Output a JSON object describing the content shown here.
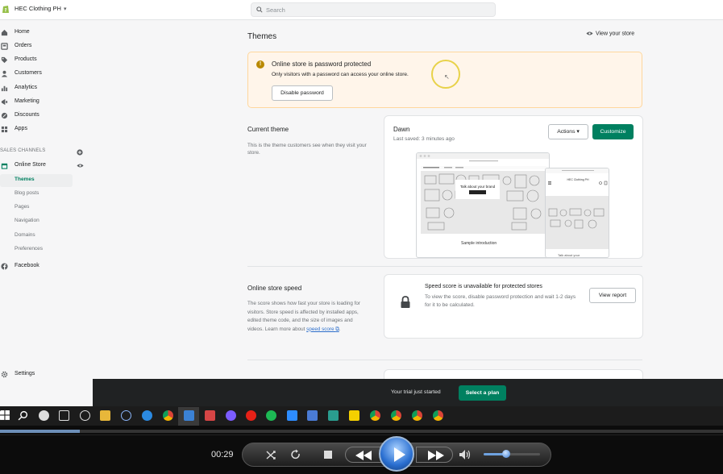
{
  "topbar": {
    "store_name": "HEC Clothing PH",
    "search_placeholder": "Search"
  },
  "sidebar": {
    "items": [
      {
        "label": "Home",
        "icon": "home-icon"
      },
      {
        "label": "Orders",
        "icon": "orders-icon"
      },
      {
        "label": "Products",
        "icon": "tag-icon"
      },
      {
        "label": "Customers",
        "icon": "person-icon"
      },
      {
        "label": "Analytics",
        "icon": "bar-chart-icon"
      },
      {
        "label": "Marketing",
        "icon": "megaphone-icon"
      },
      {
        "label": "Discounts",
        "icon": "discount-icon"
      },
      {
        "label": "Apps",
        "icon": "apps-icon"
      }
    ],
    "sales_channels_label": "SALES CHANNELS",
    "online_store_label": "Online Store",
    "online_store_sub": [
      "Themes",
      "Blog posts",
      "Pages",
      "Navigation",
      "Domains",
      "Preferences"
    ],
    "facebook_label": "Facebook",
    "settings_label": "Settings"
  },
  "main": {
    "page_title": "Themes",
    "view_store_label": "View your store",
    "banner": {
      "title": "Online store is password protected",
      "text": "Only visitors with a password can access your online store.",
      "button_label": "Disable password"
    },
    "current_theme": {
      "section_title": "Current theme",
      "section_desc": "This is the theme customers see when they visit your store.",
      "theme_name": "Dawn",
      "last_saved": "Last saved: 3 minutes ago",
      "actions_label": "Actions",
      "customize_label": "Customize",
      "preview": {
        "banner_text": "Talk about your brand",
        "sample_text": "Sample introduction",
        "mobile_store": "HEC Clothing PH",
        "mobile_caption": "Talk about your"
      }
    },
    "speed": {
      "section_title": "Online store speed",
      "section_desc": "The score shows how fast your store is loading for visitors. Store speed is affected by installed apps, edited theme code, and the size of images and videos. Learn more about",
      "link_label": "speed score",
      "card_title": "Speed score is unavailable for protected stores",
      "card_text": "To view the score, disable password protection and wait 1-2 days for it to be calculated.",
      "view_report_label": "View report"
    }
  },
  "trial_bar": {
    "text": "Your trial just started",
    "button_label": "Select a plan"
  },
  "player": {
    "time": "00:29",
    "progress": 0.11,
    "volume": 0.4
  },
  "colors": {
    "accent": "#008060",
    "banner_bg": "#fff5ea",
    "banner_border": "#ffd79d"
  }
}
